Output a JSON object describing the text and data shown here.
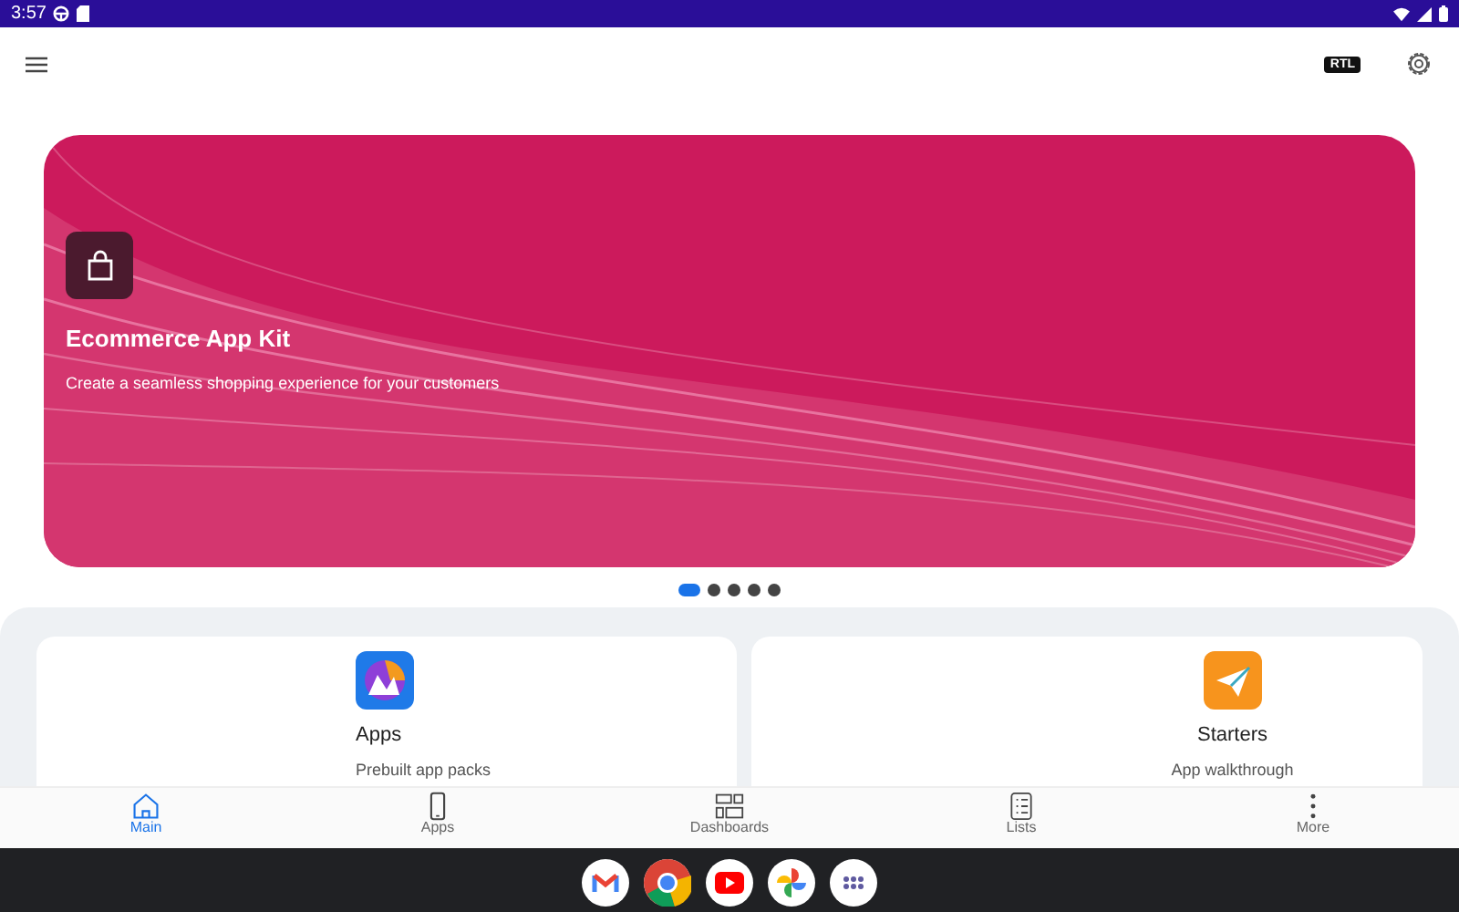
{
  "status_bar": {
    "time": "3:57"
  },
  "banner": {
    "title": "Ecommerce App Kit",
    "subtitle": "Create a seamless shopping experience for your customers"
  },
  "carousel_dots": [
    {
      "selected": true
    },
    {
      "selected": false
    },
    {
      "selected": false
    },
    {
      "selected": false
    },
    {
      "selected": false
    }
  ],
  "toolbar": {
    "rtl_label": "RTL"
  },
  "cards": [
    {
      "kind": "apps",
      "title": "Apps",
      "subtitle": "Prebuilt app packs"
    },
    {
      "kind": "starters",
      "title": "Starters",
      "subtitle": "App walkthrough"
    }
  ],
  "bottom_nav": [
    {
      "kind": "home",
      "label": "Main",
      "selected": true
    },
    {
      "kind": "phone",
      "label": "Apps",
      "selected": false
    },
    {
      "kind": "dashboards",
      "label": "Dashboards",
      "selected": false
    },
    {
      "kind": "lists",
      "label": "Lists",
      "selected": false
    },
    {
      "kind": "more",
      "label": "More",
      "selected": false
    }
  ],
  "dock": [
    {
      "kind": "mail"
    },
    {
      "kind": "browser"
    },
    {
      "kind": "video"
    },
    {
      "kind": "photos"
    },
    {
      "kind": "apps"
    }
  ]
}
